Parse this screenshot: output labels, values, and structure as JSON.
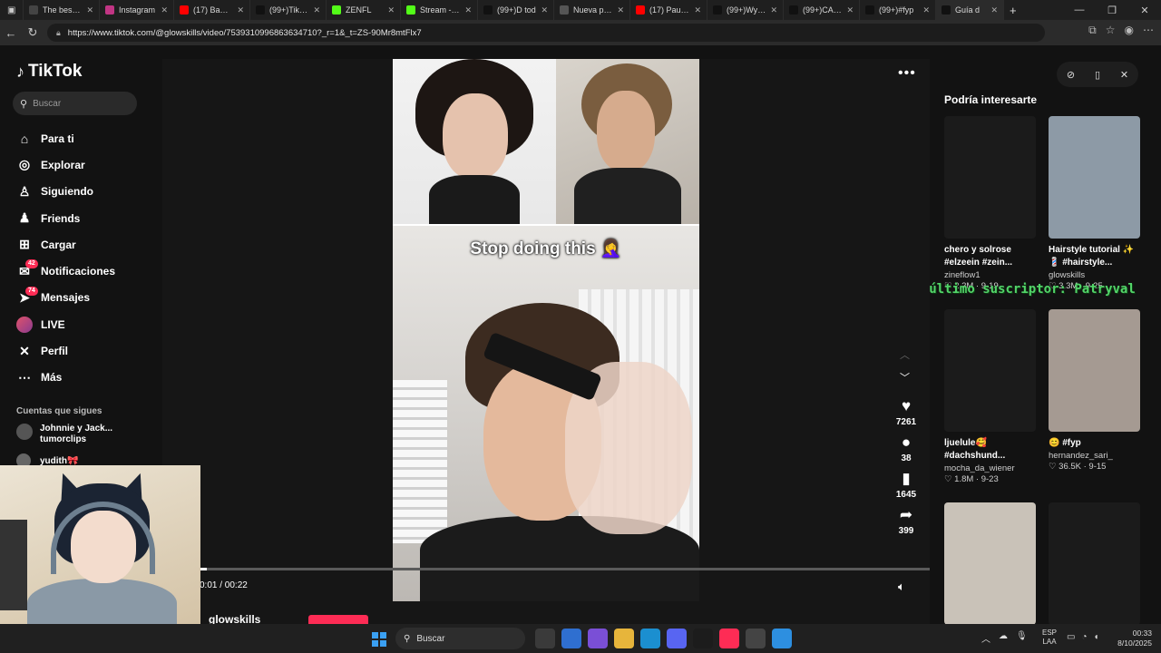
{
  "browser": {
    "tabs": [
      {
        "label": "The best Ch",
        "color": "#444444"
      },
      {
        "label": "Instagram",
        "color": "#c13584"
      },
      {
        "label": "(17) Bad Bu",
        "color": "#ff0000"
      },
      {
        "label": "(99+)TikTok",
        "color": "#111111"
      },
      {
        "label": "ZENFL",
        "color": "#53fc18"
      },
      {
        "label": "Stream - Ki",
        "color": "#53fc18"
      },
      {
        "label": "(99+)D tod",
        "color": "#111111"
      },
      {
        "label": "Nueva pest",
        "color": "#555555"
      },
      {
        "label": "(17) Paulo L",
        "color": "#ff0000"
      },
      {
        "label": "(99+)Wyatt",
        "color": "#111111"
      },
      {
        "label": "(99+)CAÑIT",
        "color": "#111111"
      },
      {
        "label": "(99+)#fyp",
        "color": "#111111"
      },
      {
        "label": "Guía d",
        "color": "#111111"
      }
    ],
    "url": "https://www.tiktok.com/@glowskills/video/7539310996863634710?_r=1&_t=ZS-90Mr8mtFlx7"
  },
  "sidebar": {
    "logo": "TikTok",
    "search_placeholder": "Buscar",
    "items": [
      {
        "label": "Para ti",
        "icon": "home-icon",
        "glyph": "⌂"
      },
      {
        "label": "Explorar",
        "icon": "compass-icon",
        "glyph": "◎"
      },
      {
        "label": "Siguiendo",
        "icon": "following-icon",
        "glyph": "♙"
      },
      {
        "label": "Friends",
        "icon": "friends-icon",
        "glyph": "♟"
      },
      {
        "label": "Cargar",
        "icon": "upload-icon",
        "glyph": "⊞"
      },
      {
        "label": "Notificaciones",
        "icon": "inbox-icon",
        "glyph": "✉",
        "badge": "42"
      },
      {
        "label": "Mensajes",
        "icon": "messages-icon",
        "glyph": "➤",
        "badge": "74"
      },
      {
        "label": "LIVE",
        "icon": "live-icon",
        "glyph": ""
      },
      {
        "label": "Perfil",
        "icon": "profile-icon",
        "glyph": "✕"
      },
      {
        "label": "Más",
        "icon": "more-icon",
        "glyph": "⋯"
      }
    ],
    "following_title": "Cuentas que sigues",
    "following": [
      {
        "name": "Johnnie y Jack...",
        "handle": "tumorclips"
      },
      {
        "name": "yudith🎀"
      }
    ]
  },
  "video": {
    "caption": "Stop doing this 🤦‍♀️",
    "likes": "7261",
    "comments": "38",
    "saves": "1645",
    "shares": "399",
    "time": "0:01 / 00:22",
    "progress": 0.01,
    "author": "glowskills"
  },
  "recommendations": {
    "title": "Podría interesarte",
    "cards": [
      {
        "title": "chero y solrose #elzeein #zein...",
        "user": "zineflow1",
        "meta": "♡ 2.2M · 9-19",
        "thumb": "#1b1b1b"
      },
      {
        "title": "Hairstyle tutorial ✨ 💈 #hairstyle...",
        "user": "glowskills",
        "meta": "♡ 3.3M · 9-25",
        "thumb": "#8d9aa6"
      },
      {
        "title": "ljuelule🥰 #dachshund...",
        "user": "mocha_da_wiener",
        "meta": "♡ 1.8M · 9-23",
        "thumb": "#1b1b1b"
      },
      {
        "title": "😊 #fyp",
        "user": "hernandez_sari_",
        "meta": "♡ 36.5K · 9-15",
        "thumb": "#a59a92"
      },
      {
        "title": "",
        "user": "",
        "meta": "",
        "thumb": "#c9c2b8"
      },
      {
        "title": "",
        "user": "",
        "meta": "",
        "thumb": "#1b1b1b"
      }
    ],
    "overlay": "último suscriptor: Patryval"
  },
  "taskbar": {
    "search": "Buscar",
    "apps": [
      {
        "name": "task-view",
        "color": "#3a3a3a"
      },
      {
        "name": "store",
        "color": "#2f6fd0"
      },
      {
        "name": "copilot",
        "color": "#7a4fd6"
      },
      {
        "name": "explorer",
        "color": "#e7b53b"
      },
      {
        "name": "edge",
        "color": "#1b8fd0"
      },
      {
        "name": "discord",
        "color": "#5865f2"
      },
      {
        "name": "fl-studio",
        "color": "#1c1c1c"
      },
      {
        "name": "tiktok",
        "color": "#fe2c55"
      },
      {
        "name": "settings",
        "color": "#444444"
      },
      {
        "name": "browser",
        "color": "#2d8fe0"
      }
    ],
    "lang": "ESP\nLAA",
    "time": "00:33",
    "date": "8/10/2025"
  }
}
